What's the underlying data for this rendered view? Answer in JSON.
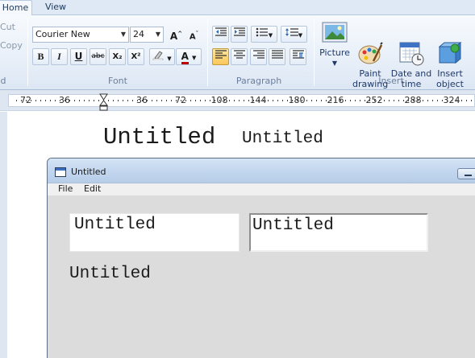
{
  "ribbon": {
    "tabs": [
      {
        "label": "Home",
        "active": true
      },
      {
        "label": "View",
        "active": false
      }
    ],
    "clipboard": {
      "cut_label": "Cut",
      "copy_label": "Copy",
      "group_label": "d"
    },
    "font": {
      "family": "Courier New",
      "size": "24",
      "group_label": "Font",
      "grow_icon": "grow-font-icon",
      "shrink_icon": "shrink-font-icon",
      "buttons": [
        "B",
        "I",
        "U",
        "abc",
        "X₂",
        "X²"
      ],
      "highlight_icon": "highlighter-icon",
      "color_label": "A",
      "color_accent": "#c00000"
    },
    "paragraph": {
      "group_label": "Paragraph",
      "alignment_selected": "left"
    },
    "insert": {
      "group_label": "Insert",
      "items": [
        {
          "label": "Picture",
          "has_dropdown": true,
          "icon": "picture-icon"
        },
        {
          "label": "Paint\ndrawing",
          "icon": "paint-palette-icon"
        },
        {
          "label": "Date and\ntime",
          "icon": "calendar-clock-icon"
        },
        {
          "label": "Insert\nobject",
          "icon": "insert-object-icon"
        }
      ]
    }
  },
  "ruler": {
    "labels": [
      "72",
      "36",
      "",
      "36",
      "72",
      "108",
      "144",
      "180",
      "216",
      "252",
      "288",
      "324"
    ]
  },
  "document": {
    "title_large": "Untitled",
    "title_small": "Untitled"
  },
  "window": {
    "title": "Untitled",
    "menu": [
      "File",
      "Edit"
    ],
    "edit_box_1": "Untitled",
    "edit_box_2": "Untitled",
    "static_label": "Untitled"
  }
}
